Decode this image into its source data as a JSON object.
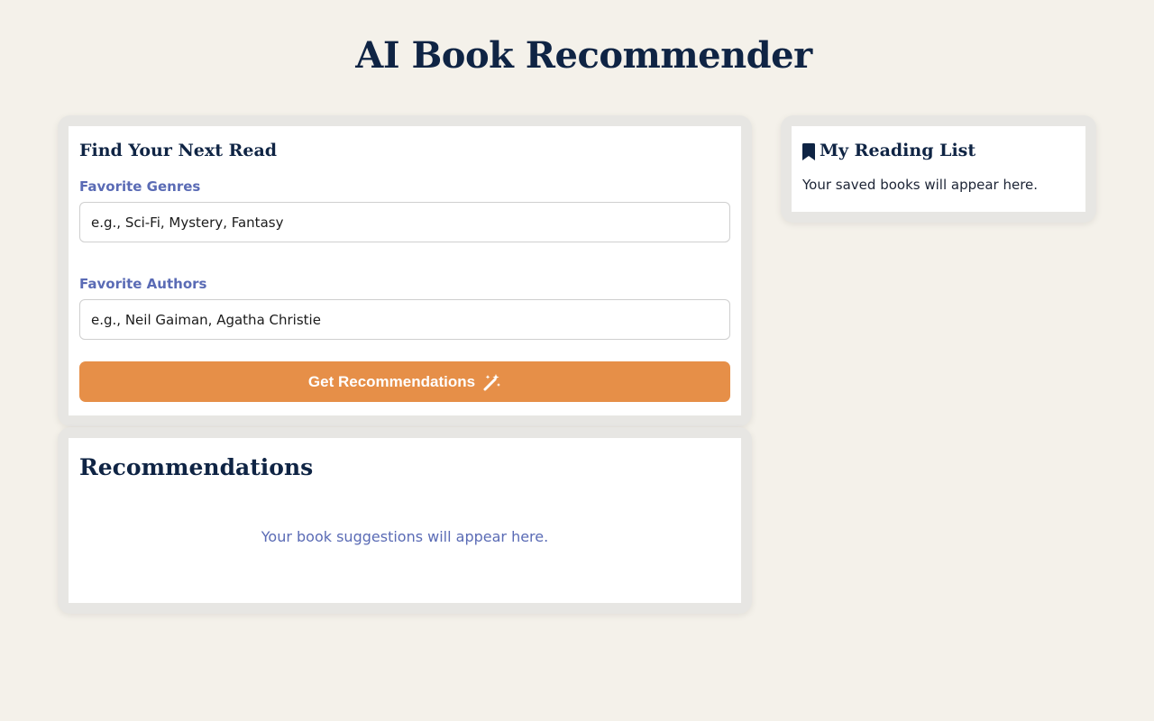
{
  "app": {
    "title": "AI Book Recommender"
  },
  "finder": {
    "heading": "Find Your Next Read",
    "genres_label": "Favorite Genres",
    "genres_placeholder": "e.g., Sci-Fi, Mystery, Fantasy",
    "genres_value": "",
    "authors_label": "Favorite Authors",
    "authors_placeholder": "e.g., Neil Gaiman, Agatha Christie",
    "authors_value": "",
    "button_label": "Get Recommendations",
    "button_icon": "magic-wand-icon"
  },
  "recommendations": {
    "heading": "Recommendations",
    "empty_text": "Your book suggestions will appear here."
  },
  "reading_list": {
    "icon": "bookmark-icon",
    "heading": "My Reading List",
    "empty_text": "Your saved books will appear here."
  },
  "colors": {
    "background": "#f4f1ea",
    "title": "#0f2444",
    "label": "#5a6bb5",
    "accent": "#e68f48"
  }
}
